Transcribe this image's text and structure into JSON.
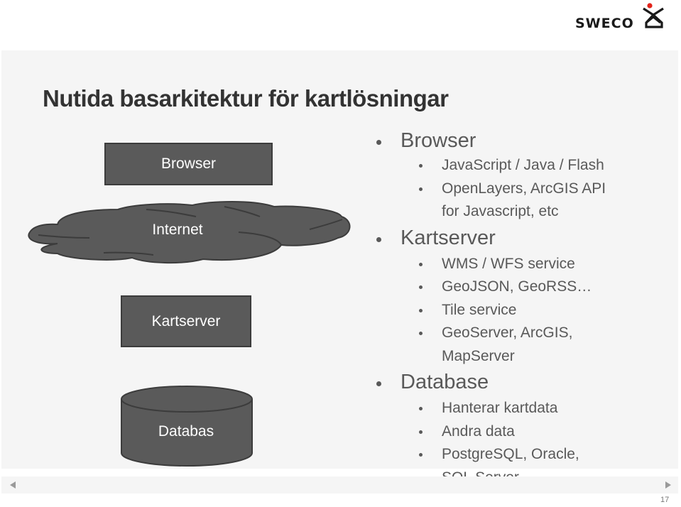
{
  "brand": {
    "name": "SWECO",
    "accent_color": "#e2231a",
    "logo_icon": "sweco-figure-icon"
  },
  "slide": {
    "title": "Nutida basarkitektur för kartlösningar",
    "page_number": "17"
  },
  "diagram": {
    "browser_label": "Browser",
    "internet_label": "Internet",
    "kartserver_label": "Kartserver",
    "database_label": "Databas",
    "shape_fill": "#5a5a5a"
  },
  "bullets": [
    {
      "label": "Browser",
      "items": [
        [
          "JavaScript / Java / Flash"
        ],
        [
          "OpenLayers, ArcGIS API",
          "for Javascript, etc"
        ]
      ]
    },
    {
      "label": "Kartserver",
      "items": [
        [
          "WMS / WFS service"
        ],
        [
          "GeoJSON, GeoRSS…"
        ],
        [
          "Tile service"
        ],
        [
          "GeoServer, ArcGIS,",
          "MapServer"
        ]
      ]
    },
    {
      "label": "Database",
      "items": [
        [
          "Hanterar kartdata"
        ],
        [
          "Andra data"
        ],
        [
          "PostgreSQL, Oracle,",
          "SQL Server"
        ]
      ]
    }
  ],
  "navigation": {
    "prev_icon": "triangle-left-icon",
    "next_icon": "triangle-right-icon"
  }
}
